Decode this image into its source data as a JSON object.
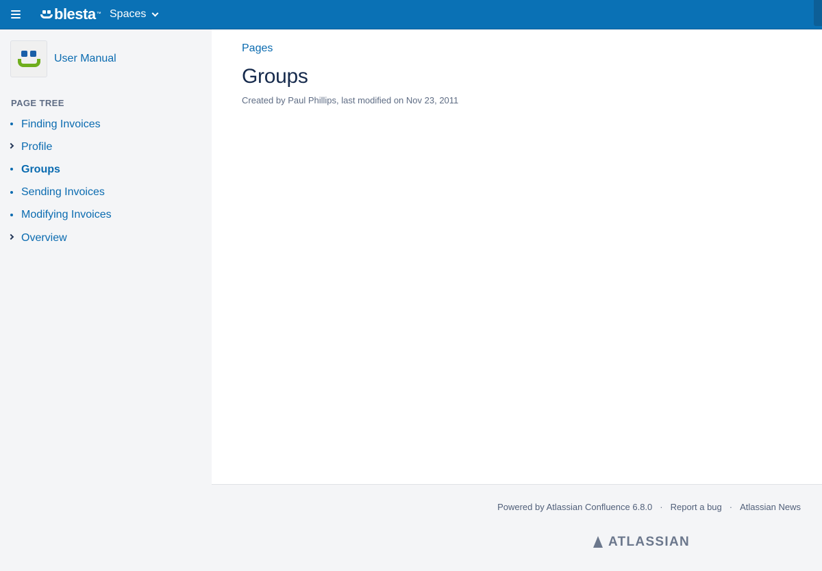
{
  "header": {
    "brand": "blesta",
    "brand_tm": "™",
    "spaces_label": "Spaces",
    "accent": "#0a71b5"
  },
  "sidebar": {
    "space_name": "User Manual",
    "tree_title": "PAGE TREE",
    "items": [
      {
        "label": "Finding Invoices",
        "marker": "bullet",
        "current": false
      },
      {
        "label": "Profile",
        "marker": "chevron-right",
        "current": false
      },
      {
        "label": "Groups",
        "marker": "bullet",
        "current": true
      },
      {
        "label": "Sending Invoices",
        "marker": "bullet",
        "current": false
      },
      {
        "label": "Modifying Invoices",
        "marker": "bullet",
        "current": false
      },
      {
        "label": "Overview",
        "marker": "chevron-right",
        "current": false
      }
    ]
  },
  "main": {
    "breadcrumb": "Pages",
    "title": "Groups",
    "byline": "Created by Paul Phillips, last modified on Nov 23, 2011"
  },
  "footer": {
    "powered_by": "Powered by Atlassian Confluence 6.8.0",
    "separator": "·",
    "report_bug": "Report a bug",
    "news": "Atlassian News",
    "vendor": "ATLASSIAN"
  },
  "colors": {
    "link": "#0a6bb0",
    "text": "#172b4d",
    "muted": "#5e6c84",
    "sidebar_bg": "#f4f5f7"
  }
}
